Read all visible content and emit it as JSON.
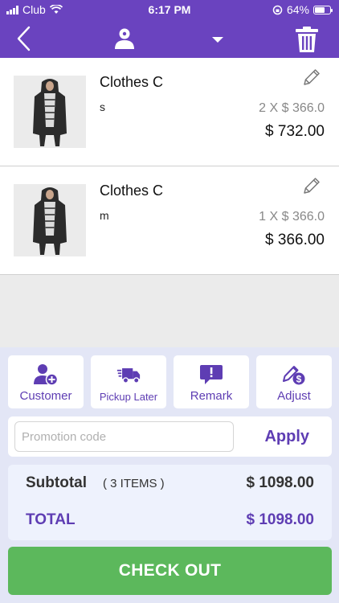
{
  "status_bar": {
    "carrier": "Club",
    "time": "6:17 PM",
    "battery": "64%",
    "battery_level": 0.64,
    "icons": [
      "signal-icon",
      "wifi-icon",
      "orientation-lock-icon",
      "battery-icon"
    ]
  },
  "nav": {
    "icons": [
      "back-chevron-icon",
      "user-icon",
      "caret-down-icon",
      "trash-icon"
    ]
  },
  "cart": {
    "items": [
      {
        "name": "Clothes C",
        "variant": "s",
        "qty_price": "2 X $ 366.0",
        "total": "$ 732.00"
      },
      {
        "name": "Clothes C",
        "variant": "m",
        "qty_price": "1 X $ 366.0",
        "total": "$ 366.00"
      }
    ]
  },
  "actions": [
    {
      "label": "Customer",
      "icon": "add-customer-icon"
    },
    {
      "label": "Pickup Later",
      "icon": "delivery-truck-icon"
    },
    {
      "label": "Remark",
      "icon": "remark-icon"
    },
    {
      "label": "Adjust",
      "icon": "adjust-price-icon"
    }
  ],
  "promo": {
    "placeholder": "Promotion code",
    "value": "",
    "apply_label": "Apply"
  },
  "summary": {
    "subtotal_label": "Subtotal",
    "items_count": "( 3 ITEMS )",
    "subtotal_value": "$ 1098.00",
    "total_label": "TOTAL",
    "total_value": "$ 1098.00"
  },
  "checkout_label": "CHECK OUT",
  "colors": {
    "primary": "#6a43bf",
    "accent_text": "#5e3db3",
    "checkout": "#5cb85c",
    "panel_bg": "#e3e6f6"
  }
}
